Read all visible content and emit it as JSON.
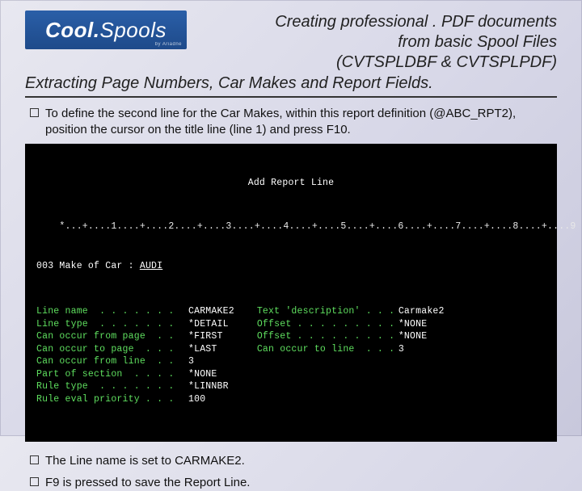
{
  "logo": {
    "brand_a": "Cool.",
    "brand_b": "Spools",
    "byline": "by Ariadne"
  },
  "title": {
    "l1": "Creating professional . PDF documents",
    "l2": "from basic Spool Files",
    "l3": "(CVTSPLDBF & CVTSPLPDF)"
  },
  "subtitle": "Extracting Page Numbers, Car Makes and Report Fields.",
  "bullets_top": [
    "To define the second line for the Car Makes, within this report definition (@ABC_RPT2), position the cursor on the title line (line 1) and press F10."
  ],
  "bullets_bottom": [
    "The Line name is set to CARMAKE2.",
    "F9 is pressed to save the Report Line."
  ],
  "terminal": {
    "title": "Add Report Line",
    "ruler": "    *...+....1....+....2....+....3....+....4....+....5....+....6....+....7....+....8....+....9",
    "context_lineno": "003",
    "context_prefix": " Make of Car : ",
    "context_value": "AUDI",
    "left": [
      {
        "label": "Line name  . . . . . . .",
        "value": "CARMAKE2"
      },
      {
        "label": "Line type  . . . . . . .",
        "value": "*DETAIL"
      },
      {
        "label": "Can occur from page  . .",
        "value": "*FIRST"
      },
      {
        "label": "Can occur to page  . . .",
        "value": "*LAST"
      },
      {
        "label": "Can occur from line  . .",
        "value": "3"
      },
      {
        "label": "Part of section  . . . .",
        "value": "*NONE"
      },
      {
        "label": "Rule type  . . . . . . .",
        "value": "*LINNBR"
      },
      {
        "label": "Rule eval priority . . .",
        "value": "100"
      }
    ],
    "right": [
      {
        "label": "Text 'description' . . .",
        "value": "Carmake2"
      },
      {
        "label": "",
        "value": ""
      },
      {
        "label": "Offset . . . . . . . . .",
        "value": "*NONE"
      },
      {
        "label": "Offset . . . . . . . . .",
        "value": "*NONE"
      },
      {
        "label": "Can occur to line  . . .",
        "value": "3"
      }
    ]
  }
}
